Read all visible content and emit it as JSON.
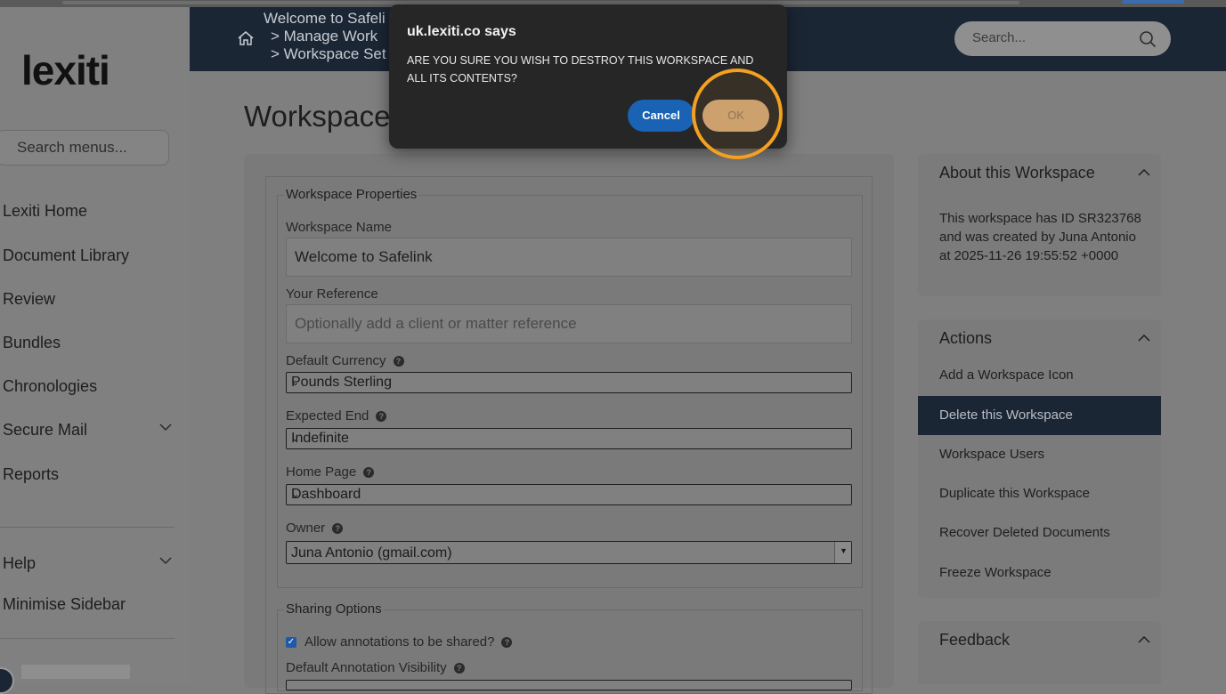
{
  "header": {
    "breadcrumbs": [
      "Welcome to Safeli",
      "> Manage Work",
      "> Workspace Set"
    ],
    "search_placeholder": "Search..."
  },
  "sidebar": {
    "logo": "lexiti",
    "search_placeholder": "Search menus...",
    "items": [
      {
        "label": "Lexiti Home"
      },
      {
        "label": "Document Library"
      },
      {
        "label": "Review"
      },
      {
        "label": "Bundles"
      },
      {
        "label": "Chronologies"
      },
      {
        "label": "Secure Mail"
      },
      {
        "label": "Reports"
      }
    ],
    "help": "Help",
    "minimise": "Minimise Sidebar"
  },
  "main": {
    "title": "Workspace",
    "properties_legend": "Workspace Properties",
    "name_label": "Workspace Name",
    "name_value": "Welcome to Safelink",
    "reference_label": "Your Reference",
    "reference_placeholder": "Optionally add a client or matter reference",
    "currency_label": "Default Currency",
    "currency_value": "Pounds Sterling",
    "expected_end_label": "Expected End",
    "expected_end_value": "Indefinite",
    "home_page_label": "Home Page",
    "home_page_value": "Dashboard",
    "owner_label": "Owner",
    "owner_value": "Juna Antonio (gmail.com)",
    "sharing_legend": "Sharing Options",
    "allow_annotations_label": "Allow annotations to be shared?",
    "annotation_visibility_label": "Default Annotation Visibility"
  },
  "right": {
    "about_title": "About this Workspace",
    "about_text": "This workspace has ID SR323768 and was created by Juna Antonio at 2025-11-26 19:55:52 +0000",
    "actions_title": "Actions",
    "actions": [
      "Add a Workspace Icon",
      "Delete this Workspace",
      "Workspace Users",
      "Duplicate this Workspace",
      "Recover Deleted Documents",
      "Freeze Workspace"
    ],
    "feedback_title": "Feedback"
  },
  "dialog": {
    "title": "uk.lexiti.co says",
    "message": "ARE YOU SURE YOU WISH TO DESTROY THIS WORKSPACE AND ALL ITS CONTENTS?",
    "cancel": "Cancel",
    "ok": "OK"
  },
  "colors": {
    "header_bg": "#1b2634",
    "cancel_blue": "#1a63b4",
    "highlight_orange": "#f4a020"
  }
}
